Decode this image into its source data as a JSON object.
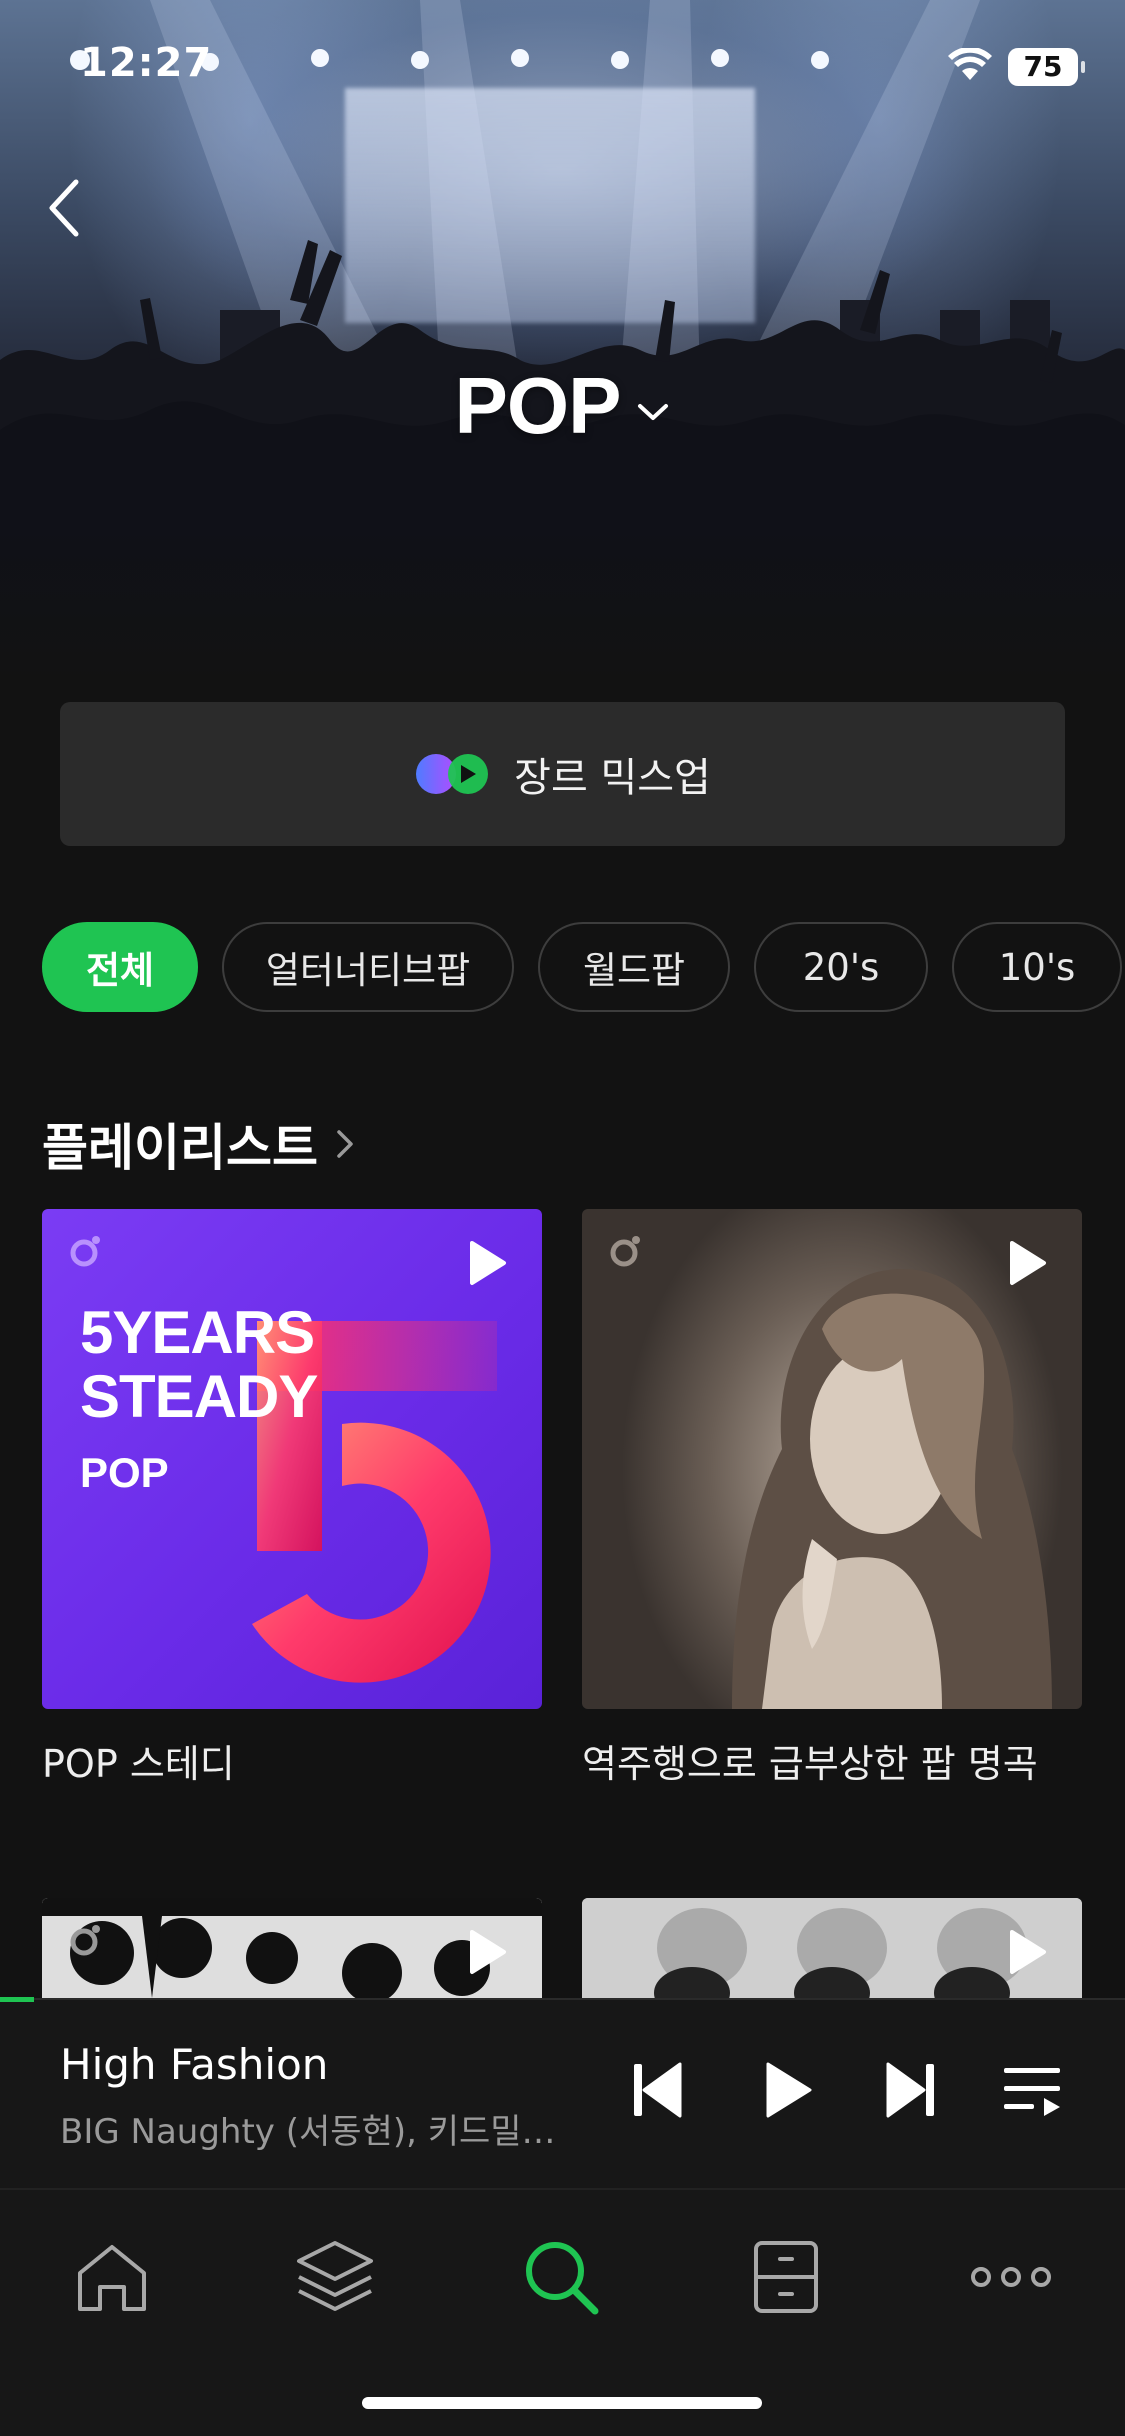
{
  "status": {
    "time": "12:27",
    "battery": "75"
  },
  "hero": {
    "title": "POP"
  },
  "mixup": {
    "label": "장르 믹스업"
  },
  "chips": [
    {
      "label": "전체",
      "active": true
    },
    {
      "label": "얼터너티브팝",
      "active": false
    },
    {
      "label": "월드팝",
      "active": false
    },
    {
      "label": "20's",
      "active": false
    },
    {
      "label": "10's",
      "active": false
    }
  ],
  "section": {
    "title": "플레이리스트"
  },
  "playlists": [
    {
      "title": "POP 스테디",
      "cover_line1": "5YEARS",
      "cover_line2": "STEADY",
      "cover_line3": "POP"
    },
    {
      "title": "역주행으로 급부상한 팝 명곡"
    }
  ],
  "player": {
    "song_title": "High Fashion",
    "artist": "BIG Naughty (서동현), 키드밀리 (Kid Milli)",
    "progress": 0.03
  },
  "tabs": [
    {
      "icon": "home-icon",
      "active": false
    },
    {
      "icon": "layers-icon",
      "active": false
    },
    {
      "icon": "search-icon",
      "active": true
    },
    {
      "icon": "library-icon",
      "active": false
    },
    {
      "icon": "more-icon",
      "active": false
    }
  ],
  "colors": {
    "accent": "#1fc452",
    "background": "#121212"
  }
}
